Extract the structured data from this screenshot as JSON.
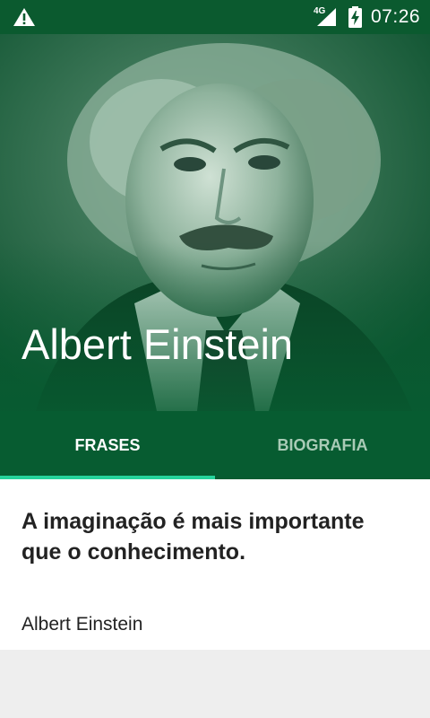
{
  "status_bar": {
    "network": "4G",
    "time": "07:26"
  },
  "header": {
    "title": "Albert Einstein"
  },
  "tabs": [
    {
      "label": "FRASES"
    },
    {
      "label": "BIOGRAFIA"
    }
  ],
  "quote": {
    "text": "A imaginação é mais importante que o conhecimento.",
    "author": "Albert Einstein"
  },
  "colors": {
    "primary": "#075c31",
    "accent": "#26d39b"
  }
}
